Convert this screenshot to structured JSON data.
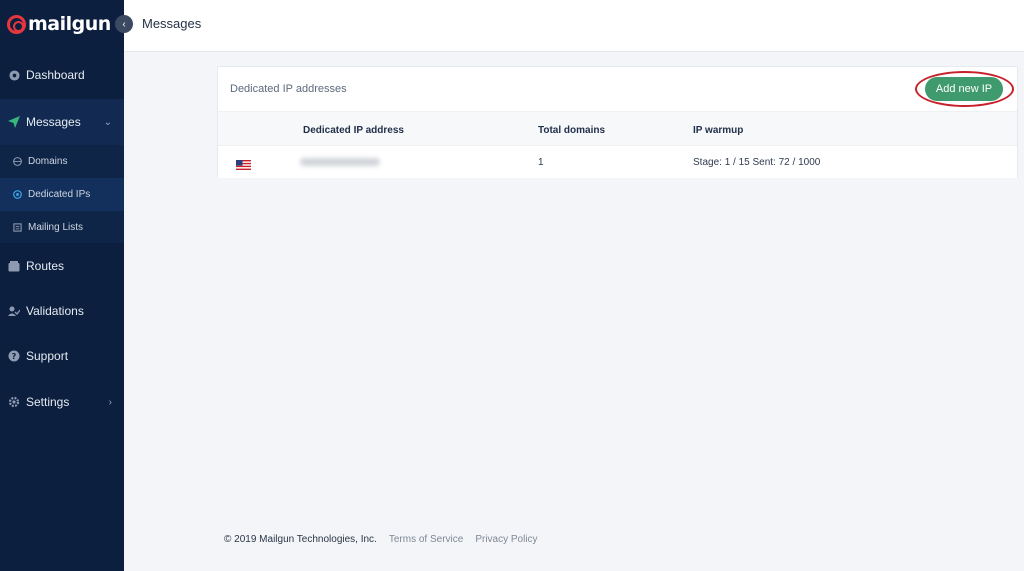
{
  "brand": {
    "logo_text": "mailgun",
    "accent": "#e8363f"
  },
  "sidebar": {
    "items": [
      {
        "label": "Dashboard",
        "icon": "dashboard-icon"
      },
      {
        "label": "Messages",
        "icon": "paper-plane-icon",
        "expanded": true
      },
      {
        "label": "Routes",
        "icon": "routes-icon"
      },
      {
        "label": "Validations",
        "icon": "validations-icon"
      },
      {
        "label": "Support",
        "icon": "question-icon"
      },
      {
        "label": "Settings",
        "icon": "gear-icon"
      }
    ],
    "sub_items": [
      {
        "label": "Domains",
        "icon": "globe-icon"
      },
      {
        "label": "Dedicated IPs",
        "icon": "target-icon",
        "selected": true
      },
      {
        "label": "Mailing Lists",
        "icon": "list-icon"
      }
    ]
  },
  "header": {
    "title": "Messages"
  },
  "card": {
    "title": "Dedicated IP addresses",
    "add_button_label": "Add new IP",
    "columns": [
      "Dedicated IP address",
      "Total domains",
      "IP warmup"
    ],
    "rows": [
      {
        "flag": "us-flag-icon",
        "ip": "",
        "total_domains": "1",
        "warmup": "Stage: 1 / 15 Sent: 72 / 1000"
      }
    ]
  },
  "footer": {
    "copyright": "© 2019 Mailgun Technologies, Inc.",
    "terms": "Terms of Service",
    "privacy": "Privacy Policy"
  },
  "colors": {
    "sidebar_bg": "#0c1f3f",
    "button_green": "#3f9a6d",
    "highlight_red": "#c8202a"
  }
}
